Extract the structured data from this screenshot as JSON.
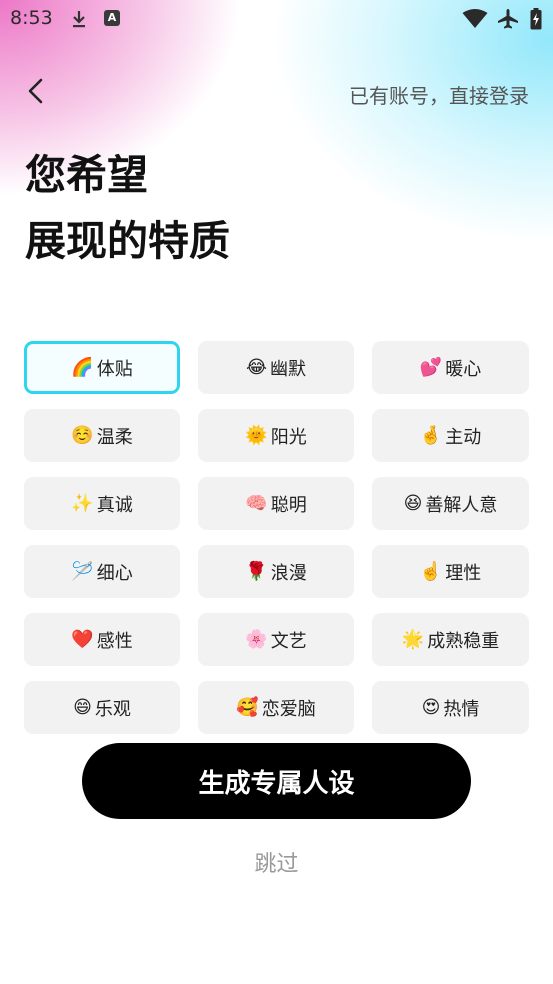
{
  "status_bar": {
    "time": "8:53",
    "app_badge": "A"
  },
  "header": {
    "login_link": "已有账号，直接登录"
  },
  "title": {
    "line1": "您希望",
    "line2": "展现的特质"
  },
  "traits": [
    {
      "emoji": "🌈",
      "label": "体贴",
      "selected": true
    },
    {
      "emoji": "😂",
      "label": "幽默",
      "selected": false
    },
    {
      "emoji": "💕",
      "label": "暖心",
      "selected": false
    },
    {
      "emoji": "☺️",
      "label": "温柔",
      "selected": false
    },
    {
      "emoji": "🌞",
      "label": "阳光",
      "selected": false
    },
    {
      "emoji": "🤞",
      "label": "主动",
      "selected": false
    },
    {
      "emoji": "✨",
      "label": "真诚",
      "selected": false
    },
    {
      "emoji": "🧠",
      "label": "聪明",
      "selected": false
    },
    {
      "emoji": "😆",
      "label": "善解人意",
      "selected": false
    },
    {
      "emoji": "🪡",
      "label": "细心",
      "selected": false
    },
    {
      "emoji": "🌹",
      "label": "浪漫",
      "selected": false
    },
    {
      "emoji": "☝️",
      "label": "理性",
      "selected": false
    },
    {
      "emoji": "❤️",
      "label": "感性",
      "selected": false
    },
    {
      "emoji": "🌸",
      "label": "文艺",
      "selected": false
    },
    {
      "emoji": "🌟",
      "label": "成熟稳重",
      "selected": false
    },
    {
      "emoji": "😄",
      "label": "乐观",
      "selected": false
    },
    {
      "emoji": "🥰",
      "label": "恋爱脑",
      "selected": false
    },
    {
      "emoji": "😍",
      "label": "热情",
      "selected": false
    }
  ],
  "actions": {
    "generate": "生成专属人设",
    "skip": "跳过"
  },
  "colors": {
    "selected_border": "#2fd4ee",
    "primary_bg": "#000000"
  }
}
